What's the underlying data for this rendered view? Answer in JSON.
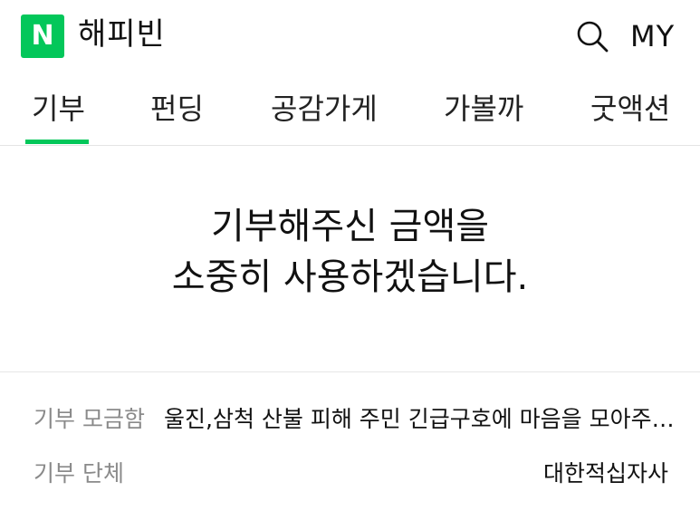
{
  "header": {
    "logo_letter": "N",
    "title": "해피빈",
    "search_icon": "search-icon",
    "my_label": "MY",
    "brand_color": "#03c75a"
  },
  "tabs": [
    {
      "label": "기부",
      "active": true
    },
    {
      "label": "펀딩",
      "active": false
    },
    {
      "label": "공감가게",
      "active": false
    },
    {
      "label": "가볼까",
      "active": false
    },
    {
      "label": "굿액션",
      "active": false
    }
  ],
  "message": {
    "line1": "기부해주신 금액을",
    "line2": "소중히 사용하겠습니다."
  },
  "info": {
    "campaign_label": "기부 모금함",
    "campaign_value": "울진,삼척 산불 피해 주민 긴급구호에 마음을 모아주…",
    "org_label": "기부 단체",
    "org_value": "대한적십자사"
  }
}
